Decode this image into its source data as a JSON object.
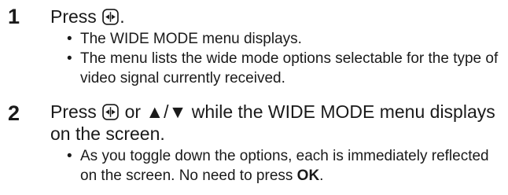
{
  "steps": [
    {
      "number": "1",
      "head_before": "Press ",
      "head_after": ".",
      "bullets": [
        "The WIDE MODE menu displays.",
        "The menu lists the wide mode options selectable for the type of video signal currently received."
      ]
    },
    {
      "number": "2",
      "head_before": "Press ",
      "head_or": " or ",
      "head_arrows": "▲/▼",
      "head_after": " while the WIDE MODE menu displays on the screen.",
      "bullet_before": "As you toggle down the options, each is immediately reflected on the screen. No need to press ",
      "bullet_ok": "OK",
      "bullet_after": "."
    }
  ],
  "icons": {
    "wide_button": "wide-mode-button-icon"
  }
}
